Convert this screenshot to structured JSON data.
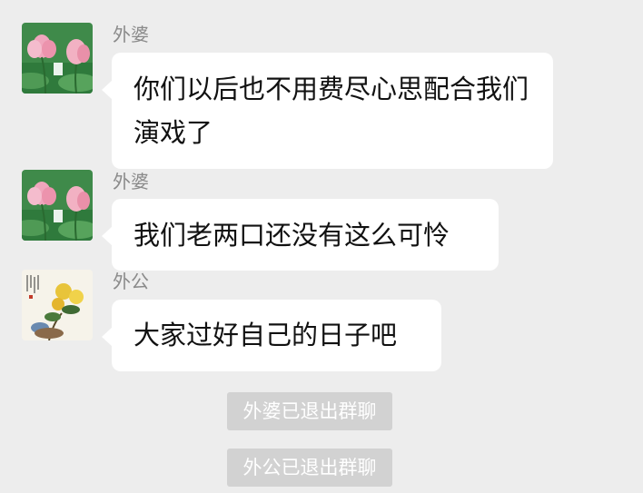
{
  "messages": [
    {
      "sender": "外婆",
      "text": "你们以后也不用费尽心思配合我们演戏了",
      "avatar_icon": "lotus-avatar-icon"
    },
    {
      "sender": "外婆",
      "text": "我们老两口还没有这么可怜",
      "avatar_icon": "lotus-avatar-icon"
    },
    {
      "sender": "外公",
      "text": "大家过好自己的日子吧",
      "avatar_icon": "chrysanthemum-painting-avatar-icon"
    }
  ],
  "system_notices": [
    "外婆已退出群聊",
    "外公已退出群聊"
  ],
  "colors": {
    "background": "#ededed",
    "bubble": "#ffffff",
    "sender_name": "#8a8a8a",
    "notice_background": "#d2d2d2",
    "notice_text": "#ffffff"
  }
}
